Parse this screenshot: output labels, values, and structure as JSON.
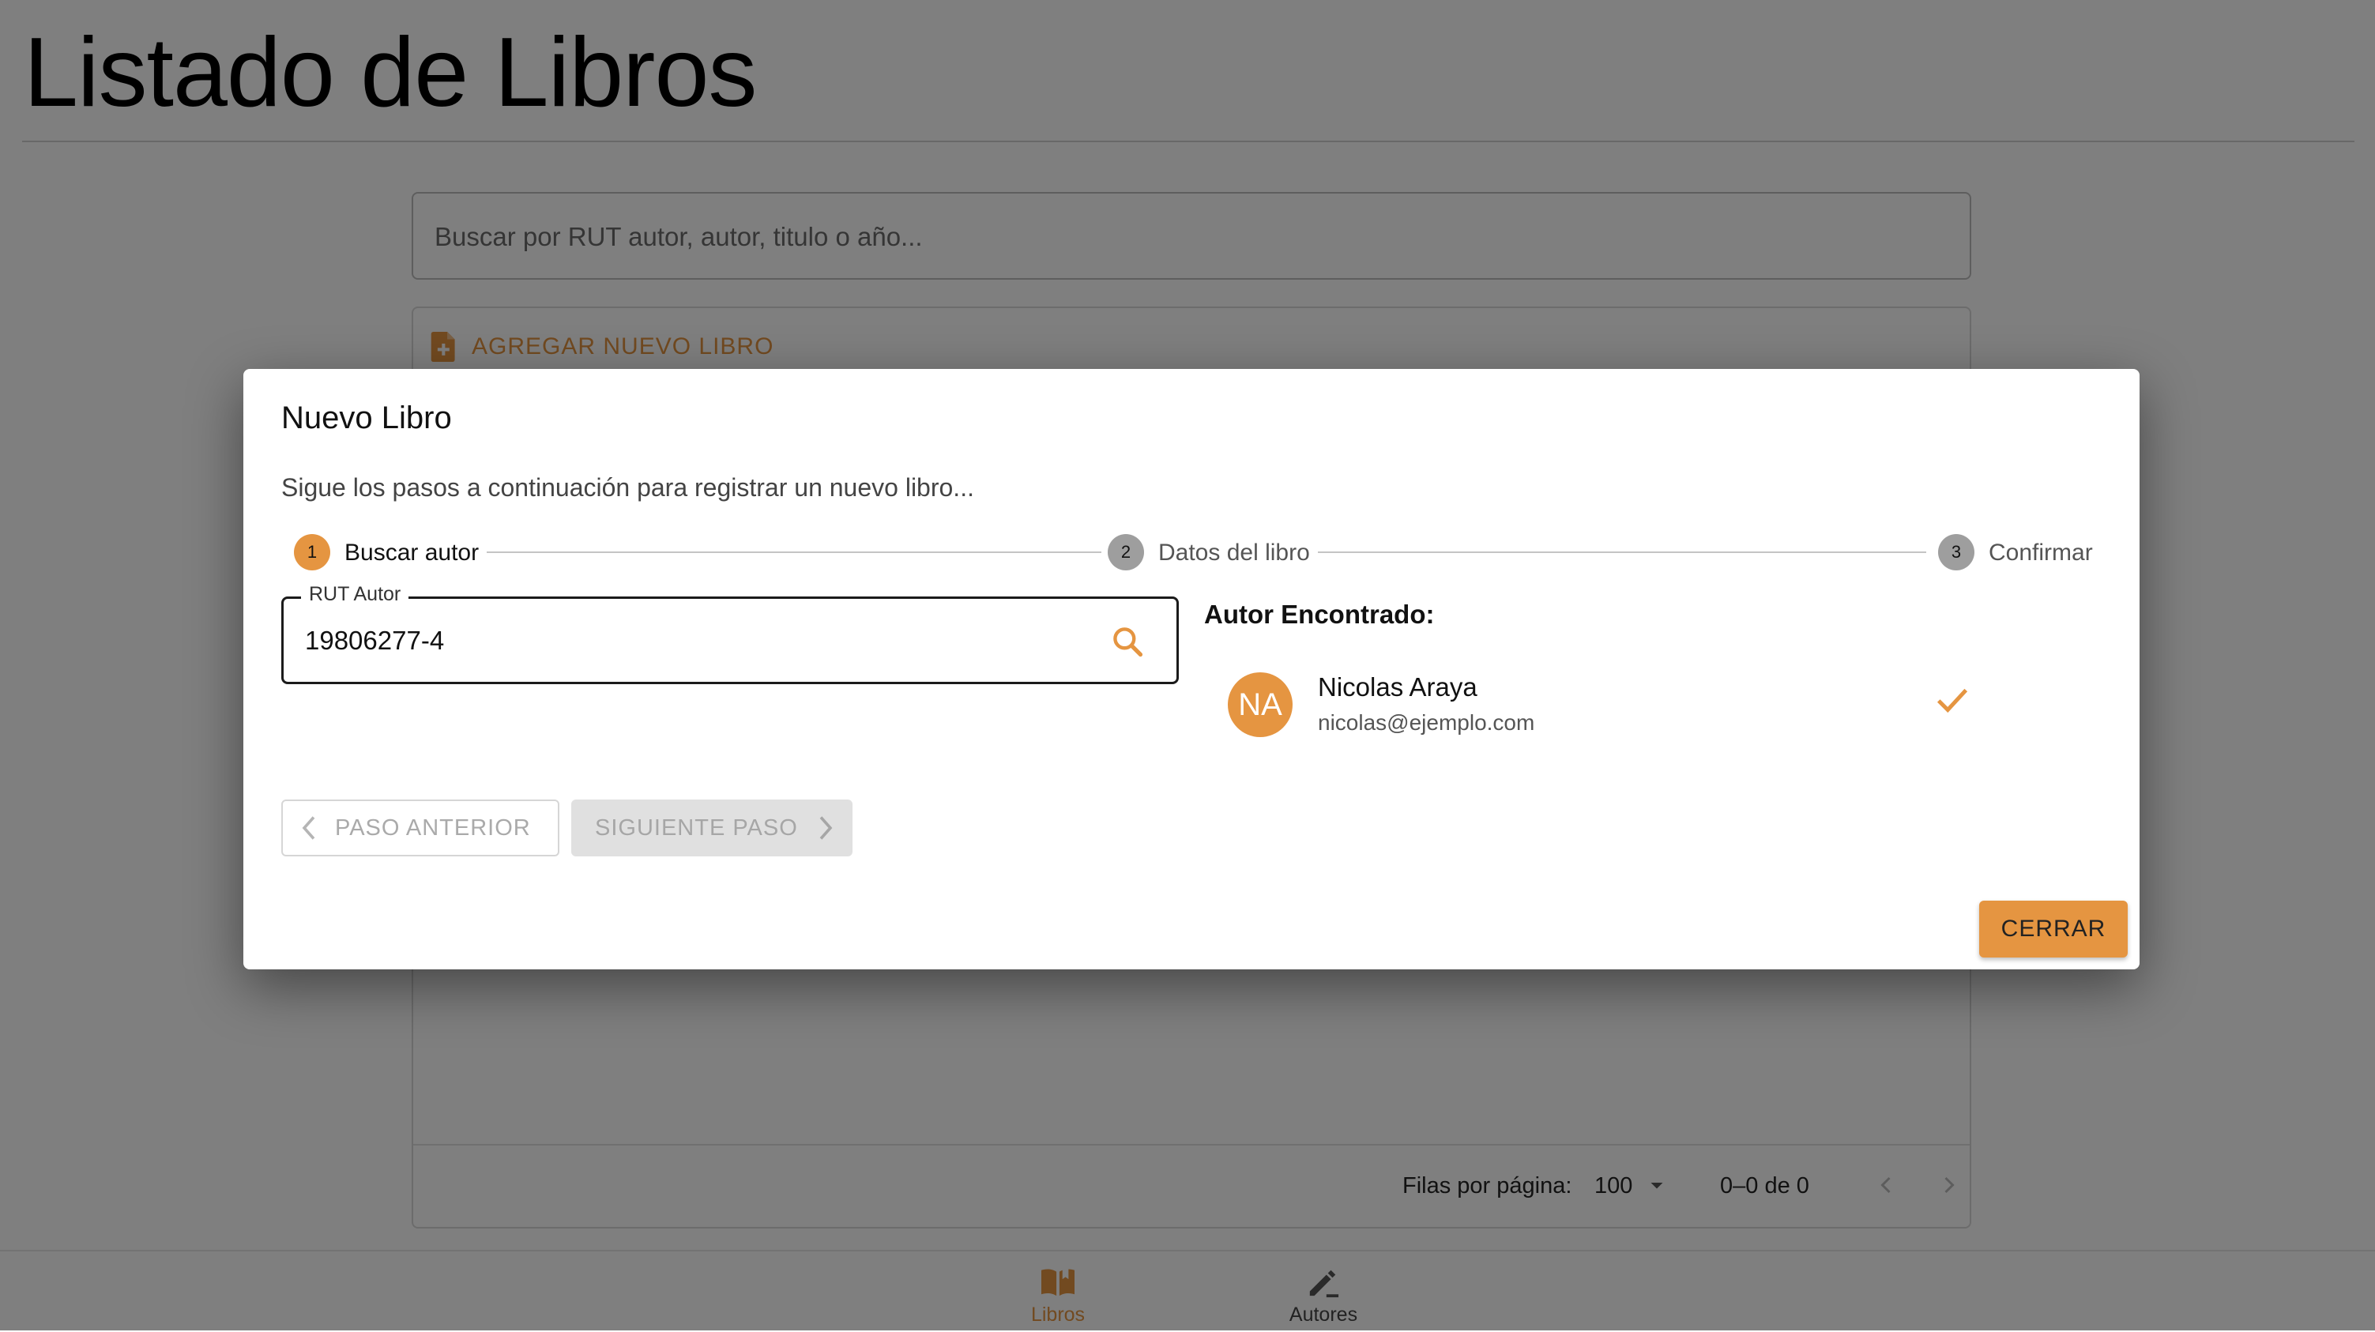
{
  "colors": {
    "accent": "#e59541",
    "scrim": "rgba(0,0,0,0.5)",
    "step_inactive": "#9e9e9e"
  },
  "page": {
    "title": "Listado de Libros",
    "search_placeholder": "Buscar por RUT autor, autor, titulo o año...",
    "add_book_label": "AGREGAR NUEVO LIBRO",
    "pagination": {
      "rows_per_page_label": "Filas por página:",
      "rows_per_page_value": "100",
      "range_label": "0–0 de 0"
    }
  },
  "bottom_nav": {
    "items": [
      {
        "label": "Libros",
        "icon": "book-open-icon",
        "active": true
      },
      {
        "label": "Autores",
        "icon": "pen-icon",
        "active": false
      }
    ]
  },
  "dialog": {
    "title": "Nuevo Libro",
    "description": "Sigue los pasos a continuación para registrar un nuevo libro...",
    "steps": [
      {
        "number": "1",
        "label": "Buscar autor",
        "active": true
      },
      {
        "number": "2",
        "label": "Datos del libro",
        "active": false
      },
      {
        "number": "3",
        "label": "Confirmar",
        "active": false
      }
    ],
    "rut_field": {
      "label": "RUT Autor",
      "value": "19806277-4"
    },
    "author_found": {
      "heading": "Autor Encontrado:",
      "initials": "NA",
      "name": "Nicolas Araya",
      "email": "nicolas@ejemplo.com"
    },
    "buttons": {
      "prev": "PASO ANTERIOR",
      "next": "SIGUIENTE PASO",
      "close": "CERRAR"
    }
  }
}
